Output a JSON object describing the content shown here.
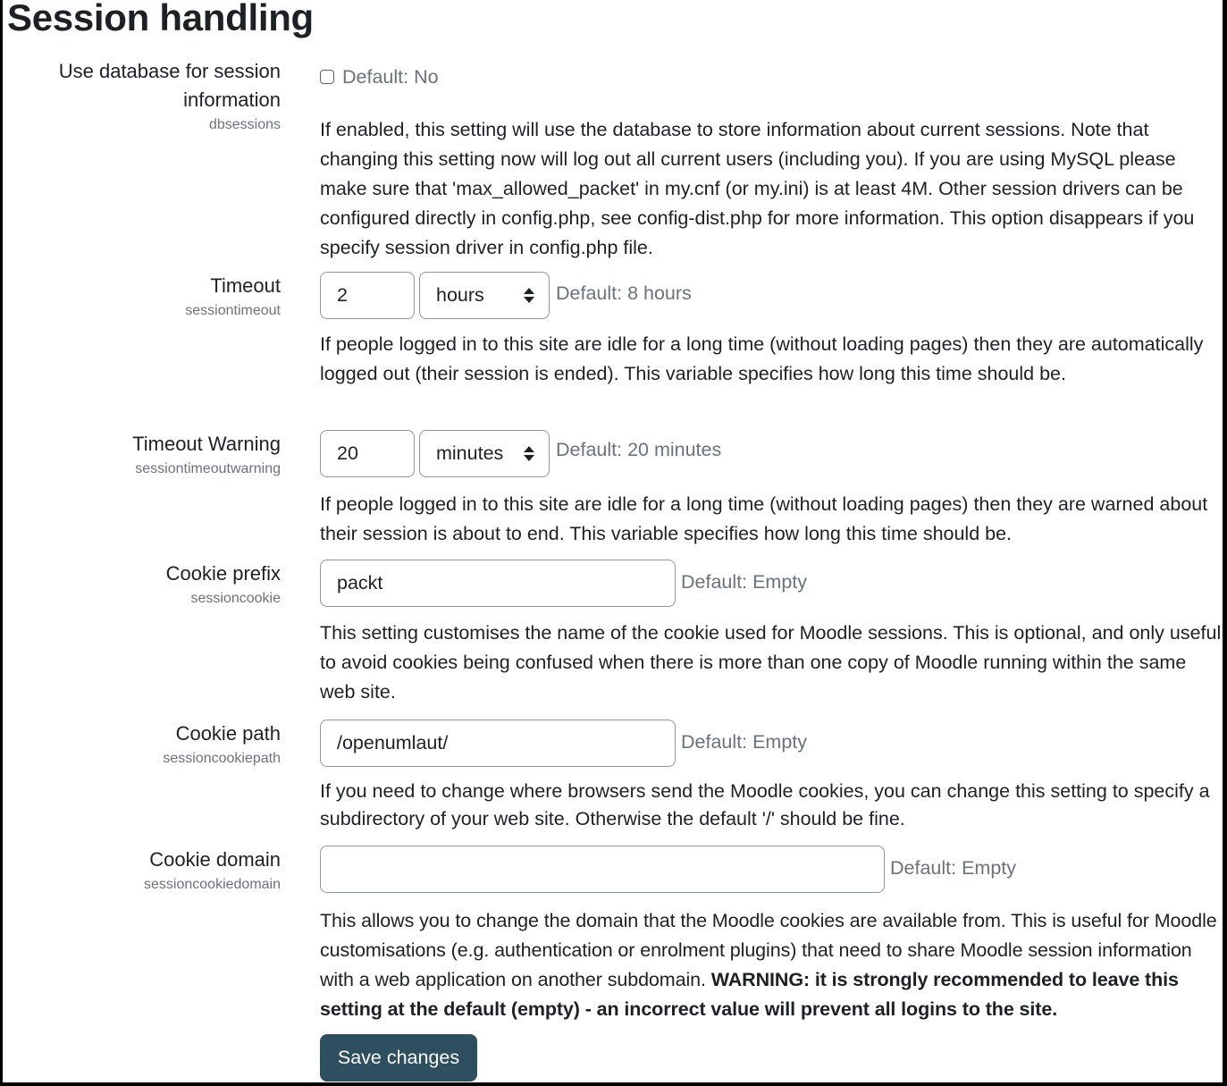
{
  "page": {
    "title": "Session handling"
  },
  "settings": {
    "dbsessions": {
      "label_line1": "Use database for session",
      "label_line2": "information",
      "key": "dbsessions",
      "checked": false,
      "default": "Default: No",
      "description": "If enabled, this setting will use the database to store information about current sessions. Note that changing this setting now will log out all current users (including you). If you are using MySQL please make sure that 'max_allowed_packet' in my.cnf (or my.ini) is at least 4M. Other session drivers can be configured directly in config.php, see config-dist.php for more information. This option disappears if you specify session driver in config.php file."
    },
    "sessiontimeout": {
      "label": "Timeout",
      "key": "sessiontimeout",
      "value": "2",
      "unit": "hours",
      "default": "Default: 8 hours",
      "description": "If people logged in to this site are idle for a long time (without loading pages) then they are automatically logged out (their session is ended). This variable specifies how long this time should be."
    },
    "sessiontimeoutwarning": {
      "label": "Timeout Warning",
      "key": "sessiontimeoutwarning",
      "value": "20",
      "unit": "minutes",
      "default": "Default: 20 minutes",
      "description": "If people logged in to this site are idle for a long time (without loading pages) then they are warned about their session is about to end. This variable specifies how long this time should be."
    },
    "sessioncookie": {
      "label": "Cookie prefix",
      "key": "sessioncookie",
      "value": "packt",
      "default": "Default: Empty",
      "description": "This setting customises the name of the cookie used for Moodle sessions. This is optional, and only useful to avoid cookies being confused when there is more than one copy of Moodle running within the same web site."
    },
    "sessioncookiepath": {
      "label": "Cookie path",
      "key": "sessioncookiepath",
      "value": "/openumlaut/",
      "default": "Default: Empty",
      "description": "If you need to change where browsers send the Moodle cookies, you can change this setting to specify a subdirectory of your web site. Otherwise the default '/' should be fine."
    },
    "sessioncookiedomain": {
      "label": "Cookie domain",
      "key": "sessioncookiedomain",
      "value": "",
      "default": "Default: Empty",
      "description": "This allows you to change the domain that the Moodle cookies are available from. This is useful for Moodle customisations (e.g. authentication or enrolment plugins) that need to share Moodle session information with a web application on another subdomain. ",
      "warning": "WARNING: it is strongly recommended to leave this setting at the default (empty) - an incorrect value will prevent all logins to the site."
    }
  },
  "actions": {
    "save_label": "Save changes"
  },
  "colors": {
    "primary_button": "#2d4f60",
    "muted_text": "#6a737b",
    "text": "#1d2125"
  }
}
